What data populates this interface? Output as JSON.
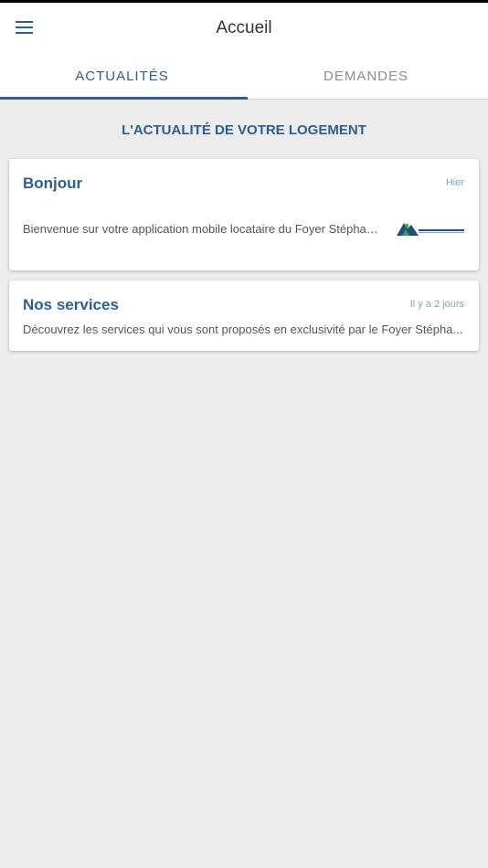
{
  "app": {
    "title": "Accueil"
  },
  "tabs": [
    {
      "label": "ACTUALITÉS",
      "active": true
    },
    {
      "label": "DEMANDES",
      "active": false
    }
  ],
  "section": {
    "title": "L'ACTUALITÉ DE VOTRE LOGEMENT"
  },
  "news": [
    {
      "title": "Bonjour",
      "date": "Hier",
      "text": "Bienvenue sur votre application mobile locataire du Foyer Stéphan...",
      "has_logo": true
    },
    {
      "title": "Nos services",
      "date": "Il y a 2 jours",
      "text": "Découvrez les services qui vous sont proposés en exclusivité par le Foyer Stépha...",
      "has_logo": false
    }
  ],
  "colors": {
    "primary": "#2f5d8f",
    "date": "#7aa5cf",
    "background": "#ececec"
  },
  "icons": {
    "menu": "hamburger-menu-icon"
  }
}
